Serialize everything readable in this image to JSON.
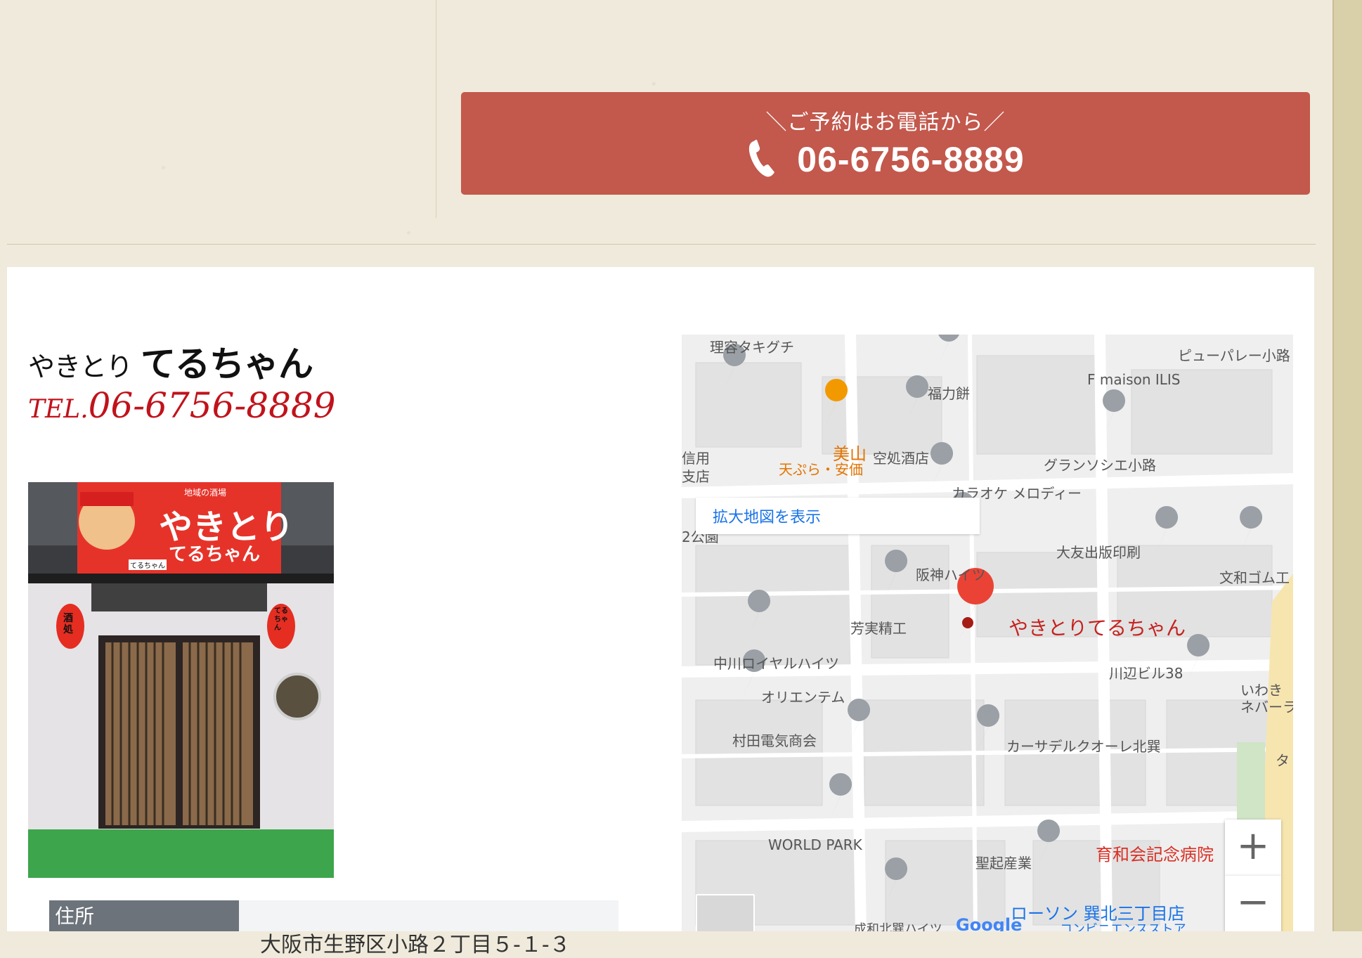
{
  "reservation": {
    "lead": "＼ご予約はお電話から／",
    "phone": "06-6756-8889"
  },
  "logo": {
    "prefix": "やきとり",
    "name": "てるちゃん",
    "tel_prefix": "TEL.",
    "tel": "06-6756-8889"
  },
  "photo": {
    "sign_small": "地域の酒場",
    "sign_main": "やきとり",
    "sign_sub": "てるちゃん",
    "lantern_left": "酒処",
    "lantern_right": "てるちゃん",
    "door_tag": "てるちゃん"
  },
  "info": {
    "address_label": "住所",
    "address_value": "大阪市生野区小路２丁目５-１-３"
  },
  "map": {
    "enlarge_link": "拡大地図を表示",
    "main_place": "やきとりてるちゃん",
    "places": [
      "理容タキグチ",
      "福力餅",
      "ピューパレー小路",
      "F maison ILIS",
      "美山",
      "天ぷら・安価",
      "空処酒店",
      "グランソシエ小路",
      "カラオケ メロディー",
      "信用",
      "支店",
      "2公園",
      "大友出版印刷",
      "文和ゴム工",
      "阪神ハイツ",
      "芳実精工",
      "中川ロイヤルハイツ",
      "川辺ビル38",
      "いわき",
      "ネバーラ",
      "オリエンテム",
      "村田電気商会",
      "カーサデルクオーレ北巽",
      "WORLD PARK",
      "聖起産業",
      "育和会記念病院",
      "ローソン 巽北三丁目店",
      "コンビニエンスストア",
      "成和北巽ハイツ",
      "タ",
      "Google"
    ],
    "zoom_in": "+",
    "zoom_out": "−"
  }
}
